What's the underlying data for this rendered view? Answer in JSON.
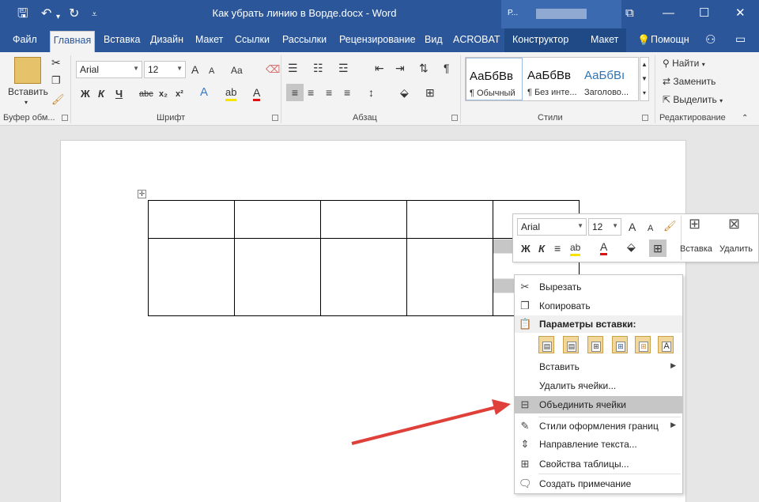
{
  "window": {
    "title": "Как убрать линию в Ворде.docx - Word",
    "user_initial": "Р..."
  },
  "qat": {
    "save_icon": "save-icon",
    "undo_icon": "undo-icon",
    "redo_icon": "redo-icon",
    "customize_icon": "customize-qat-icon"
  },
  "tabs": [
    {
      "label": "Файл"
    },
    {
      "label": "Главная"
    },
    {
      "label": "Вставка"
    },
    {
      "label": "Дизайн"
    },
    {
      "label": "Макет"
    },
    {
      "label": "Ссылки"
    },
    {
      "label": "Рассылки"
    },
    {
      "label": "Рецензирование"
    },
    {
      "label": "Вид"
    },
    {
      "label": "ACROBAT"
    },
    {
      "label": "Конструктор"
    },
    {
      "label": "Макет"
    }
  ],
  "tell_me": "Помощн",
  "ribbon": {
    "clipboard": {
      "paste": "Вставить",
      "label": "Буфер обм..."
    },
    "font": {
      "name": "Arial",
      "size": "12",
      "label": "Шрифт",
      "bold": "Ж",
      "italic": "К",
      "underline": "Ч",
      "strike": "abc",
      "sub": "x₂",
      "sup": "x²",
      "grow": "A",
      "shrink": "A",
      "case": "Aa"
    },
    "paragraph": {
      "label": "Абзац"
    },
    "styles": {
      "label": "Стили",
      "items": [
        {
          "preview": "АаБбВв",
          "name": "¶ Обычный"
        },
        {
          "preview": "АаБбВв",
          "name": "¶ Без инте..."
        },
        {
          "preview": "АаБбВı",
          "name": "Заголово..."
        }
      ]
    },
    "editing": {
      "label": "Редактирование",
      "find": "Найти",
      "replace": "Заменить",
      "select": "Выделить"
    }
  },
  "mini_toolbar": {
    "font": "Arial",
    "size": "12",
    "insert": "Вставка",
    "delete": "Удалить",
    "bold": "Ж",
    "italic": "К"
  },
  "context_menu": {
    "cut": "Вырезать",
    "copy": "Копировать",
    "paste_options": "Параметры вставки:",
    "insert": "Вставить",
    "delete_cells": "Удалить ячейки...",
    "merge_cells": "Объединить ячейки",
    "border_styles": "Стили оформления границ",
    "text_direction": "Направление текста...",
    "table_props": "Свойства таблицы...",
    "comment": "Создать примечание"
  },
  "colors": {
    "accent": "#2b579a",
    "highlight": "#c6c6c6",
    "arrow": "#e0403a"
  }
}
